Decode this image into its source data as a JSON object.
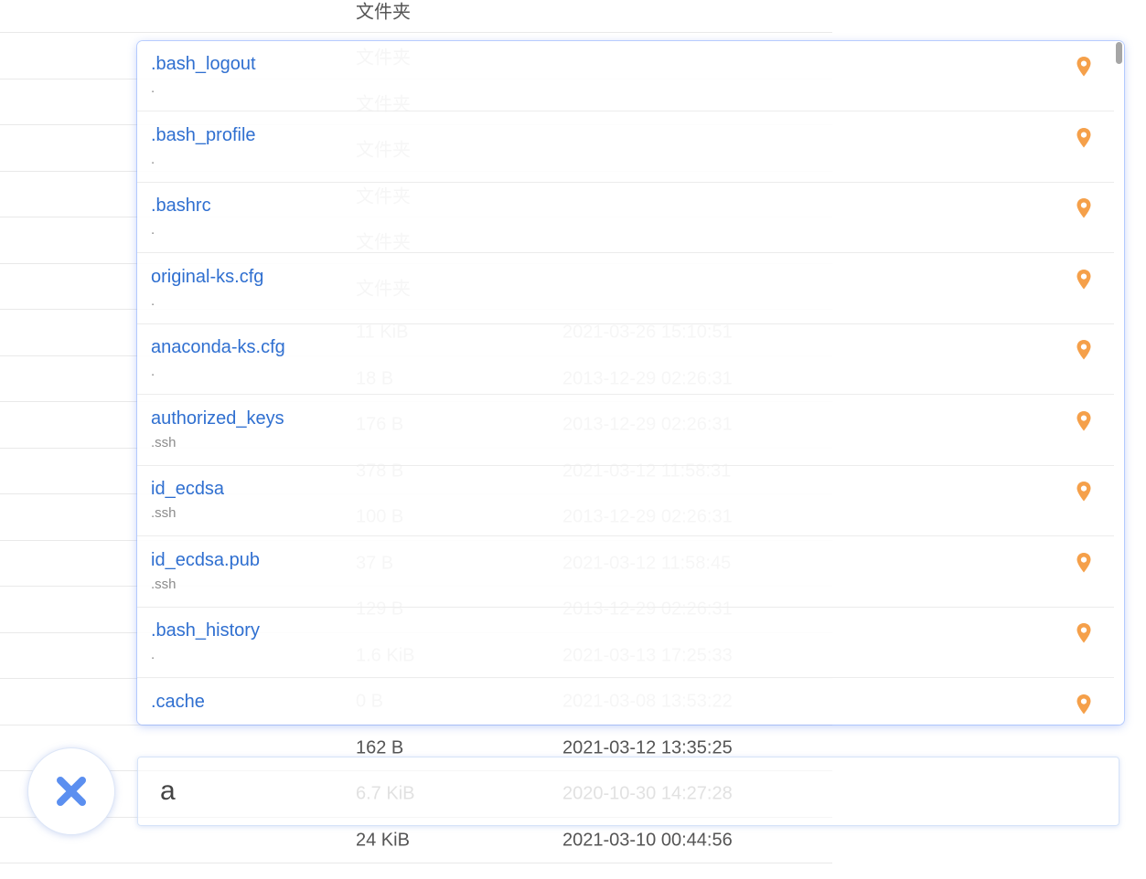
{
  "background_table": {
    "rows": [
      {
        "size": "文件夹",
        "date": "",
        "faded": false
      },
      {
        "size": "文件夹",
        "date": "",
        "faded": true
      },
      {
        "size": "文件夹",
        "date": "",
        "faded": true
      },
      {
        "size": "文件夹",
        "date": "",
        "faded": true
      },
      {
        "size": "文件夹",
        "date": "",
        "faded": true
      },
      {
        "size": "文件夹",
        "date": "",
        "faded": true
      },
      {
        "size": "文件夹",
        "date": "",
        "faded": true
      },
      {
        "size": "11 KiB",
        "date": "2021-03-26 15:10:51",
        "faded": true
      },
      {
        "size": "18 B",
        "date": "2013-12-29 02:26:31",
        "faded": true
      },
      {
        "size": "176 B",
        "date": "2013-12-29 02:26:31",
        "faded": true
      },
      {
        "size": "378 B",
        "date": "2021-03-12 11:58:31",
        "faded": true
      },
      {
        "size": "100 B",
        "date": "2013-12-29 02:26:31",
        "faded": true
      },
      {
        "size": "37 B",
        "date": "2021-03-12 11:58:45",
        "faded": true
      },
      {
        "size": "129 B",
        "date": "2013-12-29 02:26:31",
        "faded": true
      },
      {
        "size": "1.6 KiB",
        "date": "2021-03-13 17:25:33",
        "faded": true
      },
      {
        "size": "0 B",
        "date": "2021-03-08 13:53:22",
        "faded": true
      },
      {
        "size": "162 B",
        "date": "2021-03-12 13:35:25",
        "faded": false
      },
      {
        "size": "6.7 KiB",
        "date": "2020-10-30 14:27:28",
        "faded": true
      },
      {
        "size": "24 KiB",
        "date": "2021-03-10 00:44:56",
        "faded": false
      }
    ]
  },
  "search_results": {
    "items": [
      {
        "name": ".bash_logout",
        "path": "."
      },
      {
        "name": ".bash_profile",
        "path": "."
      },
      {
        "name": ".bashrc",
        "path": "."
      },
      {
        "name": "original-ks.cfg",
        "path": "."
      },
      {
        "name": "anaconda-ks.cfg",
        "path": "."
      },
      {
        "name": "authorized_keys",
        "path": ".ssh"
      },
      {
        "name": "id_ecdsa",
        "path": ".ssh"
      },
      {
        "name": "id_ecdsa.pub",
        "path": ".ssh"
      },
      {
        "name": ".bash_history",
        "path": "."
      },
      {
        "name": ".cache",
        "path": ""
      }
    ],
    "locate_icon": "map-pin-icon"
  },
  "search": {
    "value": "a"
  },
  "close_button": {
    "icon": "close-icon"
  },
  "colors": {
    "link": "#2f6fd0",
    "pin": "#f5a04a",
    "close": "#5b8ff0",
    "popup_border": "#8cafff"
  }
}
